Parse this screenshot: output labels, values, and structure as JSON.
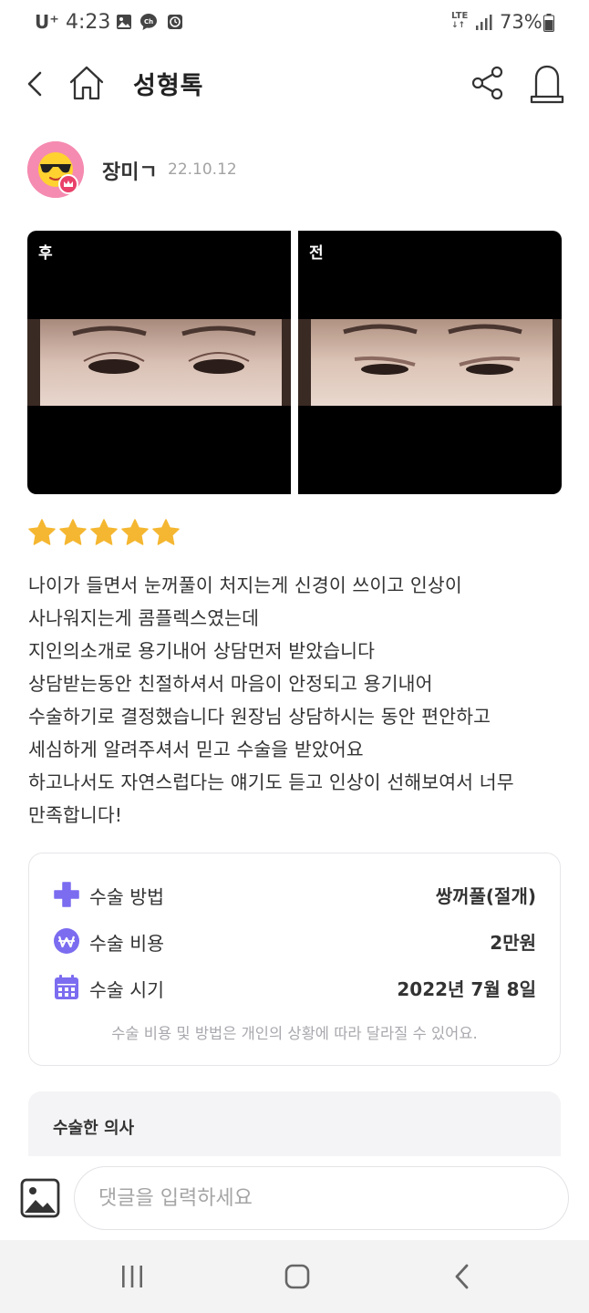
{
  "status_bar": {
    "carrier": "U⁺",
    "time": "4:23",
    "network": "LTE",
    "battery": "73%",
    "icons": [
      "gallery-icon",
      "chat-icon",
      "ch-icon",
      "clock-icon",
      "signal-icon",
      "battery-icon"
    ]
  },
  "app_bar": {
    "title": "성형톡",
    "icons": [
      "back-icon",
      "home-icon",
      "share-icon",
      "bell-icon"
    ]
  },
  "author": {
    "name": "장미ㄱ",
    "date": "22.10.12",
    "avatar": "sunglasses-emoji-avatar"
  },
  "photos": {
    "after_label": "후",
    "before_label": "전"
  },
  "rating": {
    "stars": 5,
    "max": 5,
    "color": "#f5b731"
  },
  "review": {
    "lines": [
      "나이가 들면서 눈꺼풀이 처지는게 신경이 쓰이고 인상이",
      "사나워지는게 콤플렉스였는데",
      "지인의소개로 용기내어 상담먼저 받았습니다",
      "상담받는동안 친절하셔서 마음이 안정되고 용기내어",
      "수술하기로 결정했습니다 원장님 상담하시는 동안 편안하고",
      "세심하게 알려주셔서 믿고 수술을 받았어요",
      "하고나서도 자연스럽다는 얘기도 듣고 인상이 선해보여서 너무",
      "만족합니다!"
    ]
  },
  "surgery_info": {
    "method_label": "수술 방법",
    "method_value": "쌍꺼풀(절개)",
    "cost_label": "수술 비용",
    "cost_value": "2만원",
    "date_label": "수술 시기",
    "date_value": "2022년 7월 8일",
    "note": "수술 비용 및 방법은 개인의 상황에 따라 달라질 수 있어요.",
    "accent_color": "#7b6cf0"
  },
  "doctor_section": {
    "title": "수술한 의사"
  },
  "comment": {
    "placeholder": "댓글을 입력하세요"
  }
}
